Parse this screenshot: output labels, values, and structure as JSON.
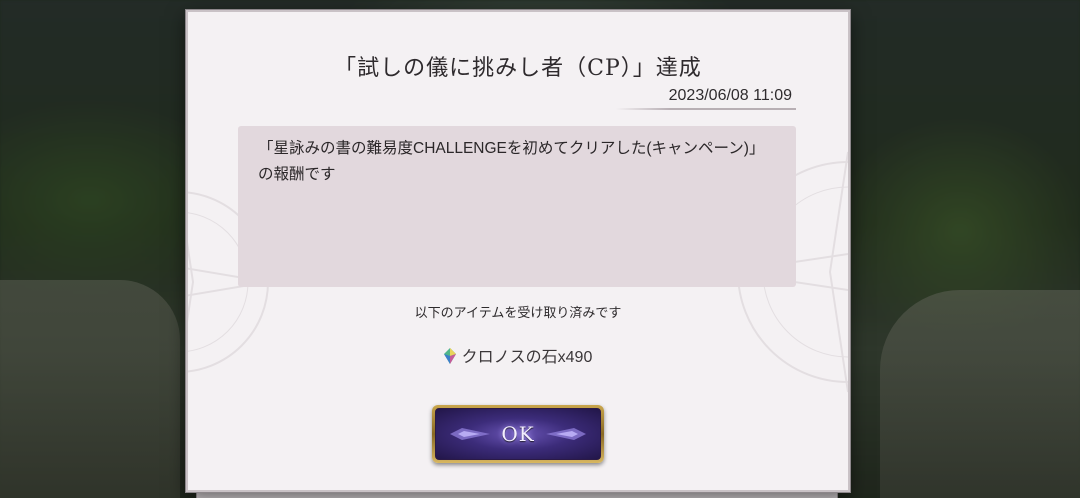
{
  "dialog": {
    "title": "「試しの儀に挑みし者（CP）」達成",
    "date": "2023/06/08 11:09",
    "message": "「星詠みの書の難易度CHALLENGEを初めてクリアした(キャンペーン)」の報酬です",
    "received_notice": "以下のアイテムを受け取り済みです",
    "item": {
      "icon": "chronos-stone-icon",
      "label": "クロノスの石x490"
    },
    "ok_label": "OK"
  },
  "colors": {
    "dialog_bg": "#f4f1f3",
    "message_bg": "#e2d8dd",
    "button_purple": "#3c2c7a",
    "button_gold": "#c9a64c"
  }
}
